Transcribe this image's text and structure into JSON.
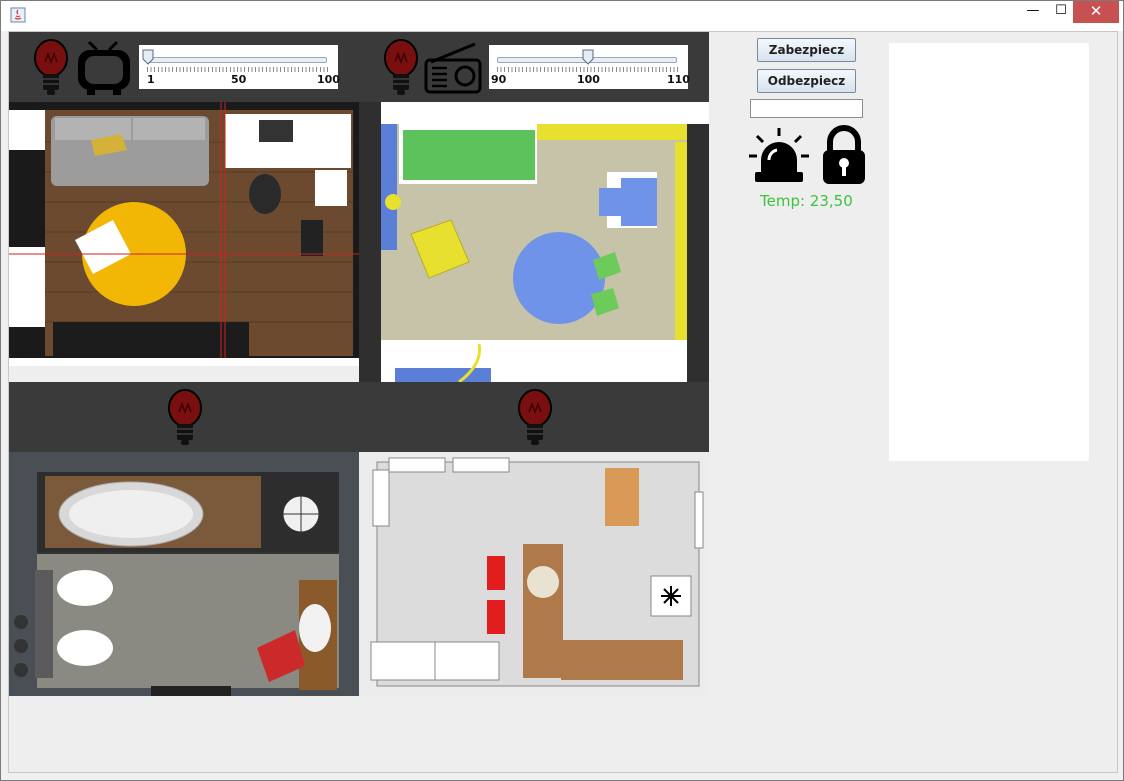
{
  "buttons": {
    "secure_label": "Zabezpiecz",
    "unsecure_label": "Odbezpiecz"
  },
  "tv_slider": {
    "min_label": "1",
    "mid_label": "50",
    "max_label": "100",
    "value": 1
  },
  "radio_slider": {
    "min_label": "90",
    "mid_label": "100",
    "max_label": "110",
    "value": 100
  },
  "status": {
    "temperature_text": "Temp: 23,50",
    "code_input_value": ""
  },
  "icons": {
    "bulb": "light-bulb-icon",
    "tv": "tv-icon",
    "radio": "radio-icon",
    "alarm": "siren-icon",
    "lock": "padlock-icon"
  },
  "colors": {
    "temperature": "#3cc43c",
    "bulb_off": "#7a0f0f",
    "toolbar_bg": "#3a3a3a"
  },
  "window": {
    "close_glyph": "✕",
    "max_glyph": "☐",
    "min_glyph": "—"
  }
}
